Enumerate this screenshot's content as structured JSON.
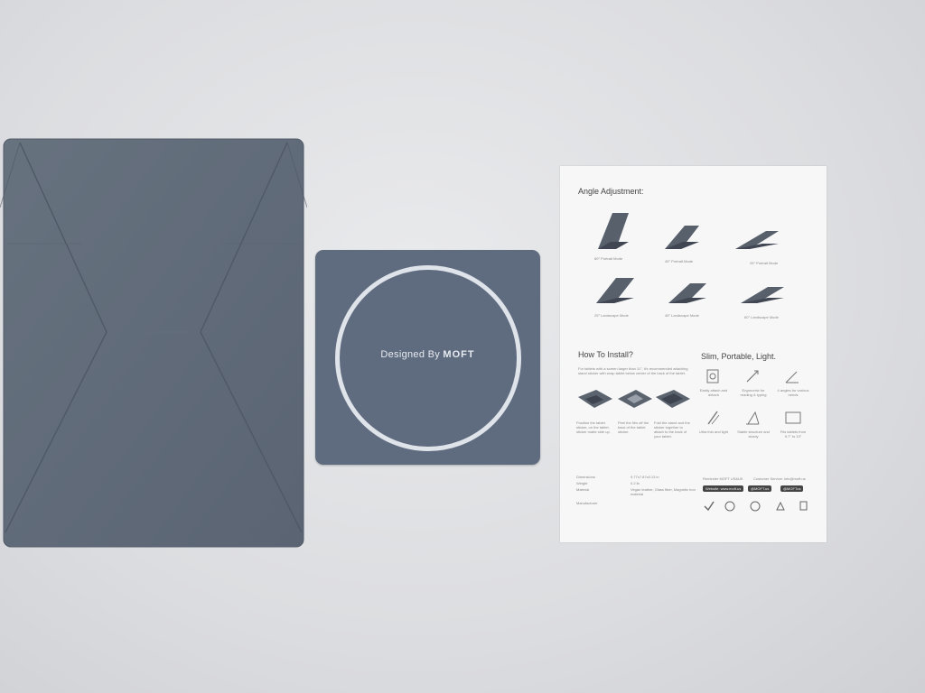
{
  "sticker": {
    "text_prefix": "Designed By",
    "brand": "MOFT"
  },
  "manual": {
    "angle_title": "Angle Adjustment:",
    "angle_modes": [
      "60° Portrait Mode",
      "45° Portrait Mode",
      "25° Portrait Mode",
      "25° Landscape Mode",
      "45° Landscape Mode",
      "60° Landscape Mode"
    ],
    "install_title": "How To Install?",
    "install_intro": "For tablets with a screen larger than 11\", it's recommended attaching stand sticker with wrap tablet below center of the back of the tablet.",
    "install_steps": [
      "Position the tablet sticker, on the tablet, sticker matte side up.",
      "Peel the film off the back of the tablet sticker.",
      "Fold the stand and the sticker together to attach to the back of your tablet."
    ],
    "features_title": "Slim, Portable, Light.",
    "features": [
      "Easily attach and detach",
      "Ergonomic for reading & typing",
      "4 angles for various needs",
      "Ultra thin and light",
      "Stable structure and sturdy",
      "Fits tablets from 9.7\" to 13\""
    ],
    "specs_labels": [
      "Dimensions",
      "Weight",
      "Material",
      "Manufacturer"
    ],
    "specs_values": [
      "9.77x7.87x0.13 in",
      "0.2 lb",
      "Vegan leather, Glass fiber, Magnetic iron material",
      ""
    ],
    "contact_left": "Reminder MOFT US&UK",
    "contact_right": "Customer Service: info@moft.us",
    "social": [
      "Website: www.moft.us",
      "@MOFT.us",
      "@MOFTus"
    ]
  }
}
